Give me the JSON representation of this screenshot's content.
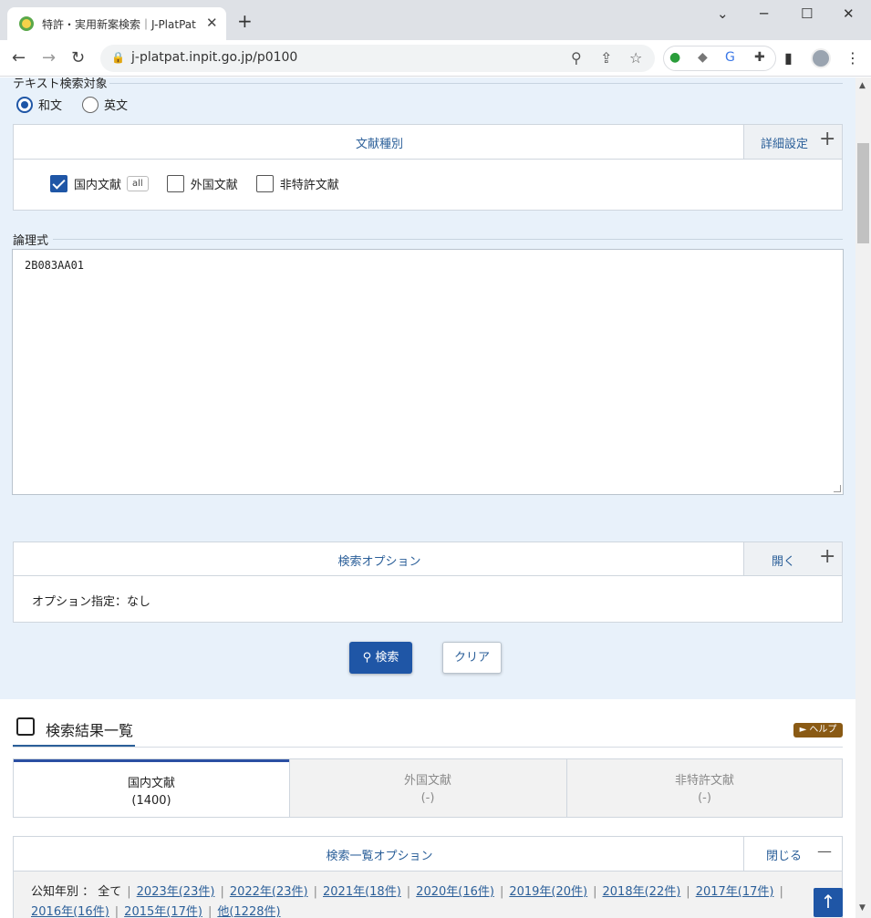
{
  "browser": {
    "tab_title": "特許・実用新案検索｜J-PlatPat [JPP]",
    "tab_close": "✕",
    "new_tab": "+",
    "url": "j-platpat.inpit.go.jp/p0100",
    "win_min": "─",
    "win_max": "☐",
    "win_close": "✕",
    "win_chevron": "⌄"
  },
  "text_target": {
    "legend": "テキスト検索対象",
    "options": [
      {
        "label": "和文",
        "selected": true
      },
      {
        "label": "英文",
        "selected": false
      }
    ]
  },
  "doc_type": {
    "title": "文献種別",
    "toggle_label": "詳細設定",
    "toggle_sign": "+",
    "checks": [
      {
        "label": "国内文献",
        "checked": true
      },
      {
        "label": "外国文献",
        "checked": false
      },
      {
        "label": "非特許文献",
        "checked": false
      }
    ],
    "all_badge": "all"
  },
  "formula": {
    "label": "論理式",
    "value": "2B083AA01"
  },
  "search_option": {
    "title": "検索オプション",
    "toggle_label": "開く",
    "toggle_sign": "+",
    "text": "オプション指定：なし"
  },
  "buttons": {
    "search": "検索",
    "clear": "クリア"
  },
  "results": {
    "title": "検索結果一覧",
    "help": "► ヘルプ",
    "tabs": [
      {
        "label": "国内文献",
        "count": "(1400)",
        "active": true
      },
      {
        "label": "外国文献",
        "count": "(-)",
        "active": false
      },
      {
        "label": "非特許文献",
        "count": "(-)",
        "active": false
      }
    ]
  },
  "list_option": {
    "title": "検索一覧オプション",
    "toggle_label": "閉じる",
    "toggle_sign": "—",
    "year_prefix": "公知年別 ： 全て",
    "years": [
      "2023年(23件)",
      "2022年(23件)",
      "2021年(18件)",
      "2020年(16件)",
      "2019年(20件)",
      "2018年(22件)",
      "2017年(17件)",
      "2016年(16件)",
      "2015年(17件)",
      "他(1228件)"
    ]
  },
  "to_top": "↑"
}
